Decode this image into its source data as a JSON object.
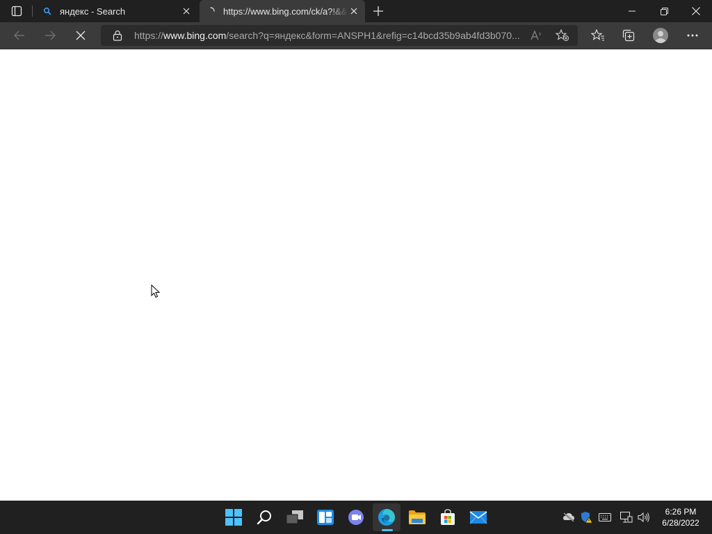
{
  "browser": {
    "tabs": [
      {
        "title": "яндекс - Search",
        "favicon": "bing-search-icon",
        "active": false
      },
      {
        "title": "https://www.bing.com/ck/a?!&&",
        "favicon": "loading-icon",
        "active": true
      }
    ],
    "address_bar": {
      "scheme": "https://",
      "host": "www.bing.com",
      "path": "/search?q=яндекс&form=ANSPH1&refig=c14bcd35b9ab4fd3b070..."
    }
  },
  "taskbar": {
    "apps": [
      "start",
      "search",
      "task-view",
      "widgets",
      "teams-chat",
      "edge",
      "file-explorer",
      "microsoft-store",
      "mail"
    ],
    "clock": {
      "time": "6:26 PM",
      "date": "6/28/2022"
    }
  },
  "colors": {
    "tab_bar": "#202020",
    "toolbar": "#3b3b3b",
    "address_bar": "#2b2b2b",
    "taskbar": "#202020",
    "accent": "#4cc2ff",
    "page": "#ffffff"
  }
}
